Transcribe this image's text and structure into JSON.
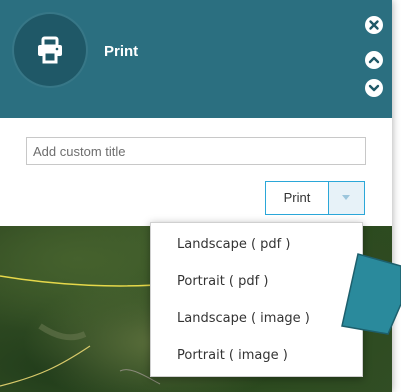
{
  "header": {
    "title": "Print",
    "icon": "printer-icon"
  },
  "window_controls": {
    "close": "close-icon",
    "up": "chevron-up-icon",
    "down": "chevron-down-icon"
  },
  "title_field": {
    "placeholder": "Add custom title",
    "value": ""
  },
  "print_button": {
    "label": "Print"
  },
  "print_menu": {
    "items": [
      {
        "label": "Landscape ( pdf )"
      },
      {
        "label": "Portrait ( pdf )"
      },
      {
        "label": "Landscape ( image )"
      },
      {
        "label": "Portrait ( image )"
      }
    ]
  },
  "colors": {
    "header_bg": "#2b6f80",
    "accent_border": "#2ba7d8",
    "pointer_fill": "#2a8a9c"
  }
}
